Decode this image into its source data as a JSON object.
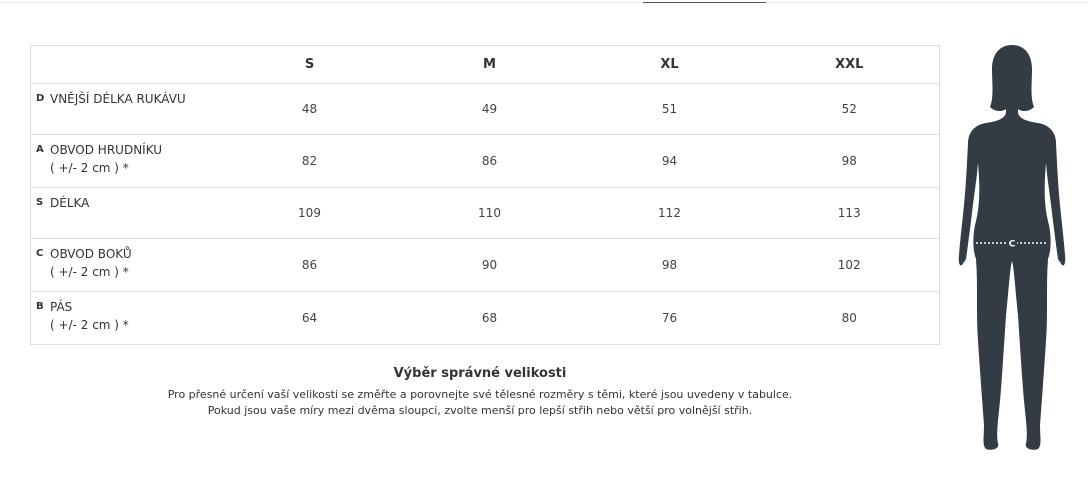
{
  "table": {
    "headers": [
      "",
      "S",
      "M",
      "XL",
      "XXL"
    ],
    "rows": [
      {
        "letter": "D",
        "label": "VNĚJŠÍ DÉLKA RUKÁVU",
        "note": "",
        "values": [
          "48",
          "49",
          "51",
          "52"
        ]
      },
      {
        "letter": "A",
        "label": "OBVOD HRUDNÍKU",
        "note": "( +/- 2 cm ) *",
        "values": [
          "82",
          "86",
          "94",
          "98"
        ]
      },
      {
        "letter": "S",
        "label": "DÉLKA",
        "note": "",
        "values": [
          "109",
          "110",
          "112",
          "113"
        ]
      },
      {
        "letter": "C",
        "label": "OBVOD BOKŮ",
        "note": "( +/- 2 cm ) *",
        "values": [
          "86",
          "90",
          "98",
          "102"
        ]
      },
      {
        "letter": "B",
        "label": "PÁS",
        "note": "( +/- 2 cm ) *",
        "values": [
          "64",
          "68",
          "76",
          "80"
        ]
      }
    ]
  },
  "advice": {
    "title": "Výběr správné velikosti",
    "line1": "Pro přesné určení vaší velikosti se změřte a porovnejte své tělesné rozměry s těmi, které jsou uvedeny v tabulce.",
    "line2": "Pokud jsou vaše míry mezi dvěma sloupci, zvolte menší pro lepší střih nebo větší pro volnější střih."
  },
  "figure": {
    "measure_letter": "C",
    "color": "#333b45"
  }
}
